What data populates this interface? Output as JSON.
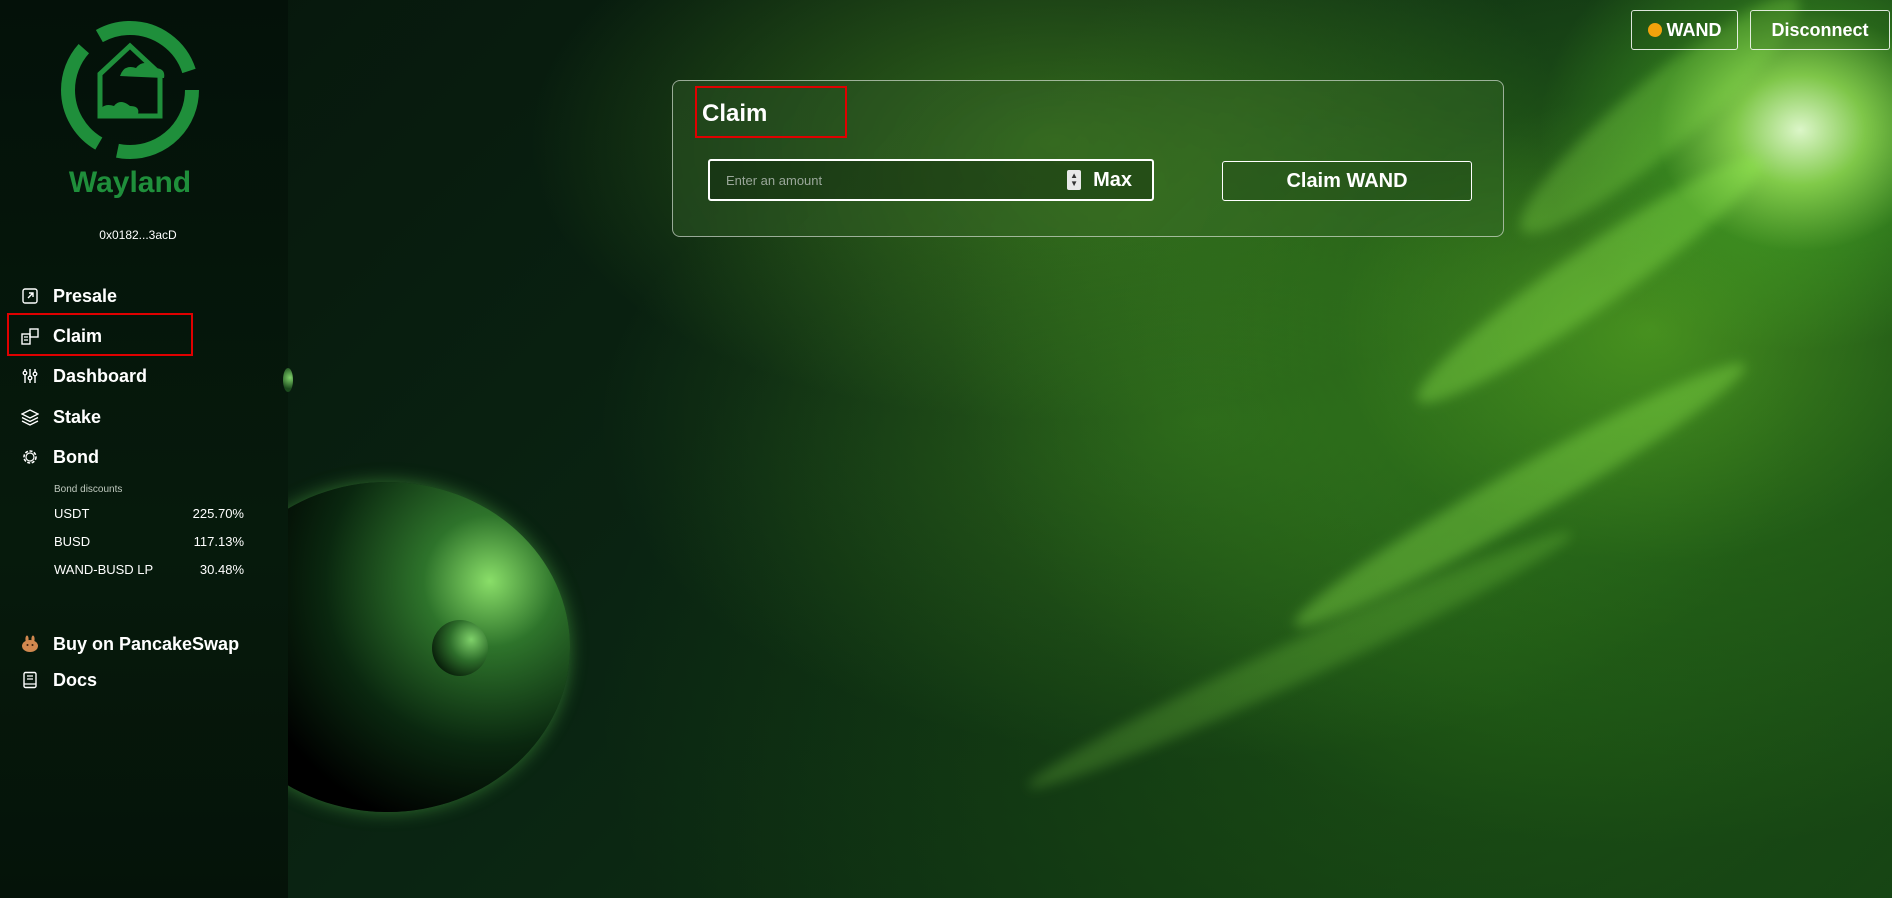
{
  "brand": {
    "name": "Wayland",
    "address": "0x0182...3acD"
  },
  "sidebar": {
    "items": [
      {
        "label": "Presale",
        "icon": "external-link-icon"
      },
      {
        "label": "Claim",
        "icon": "claim-icon"
      },
      {
        "label": "Dashboard",
        "icon": "sliders-icon"
      },
      {
        "label": "Stake",
        "icon": "layers-icon"
      },
      {
        "label": "Bond",
        "icon": "gear-icon"
      }
    ],
    "bond_discounts": {
      "label": "Bond discounts",
      "rows": [
        {
          "name": "USDT",
          "value": "225.70%"
        },
        {
          "name": "BUSD",
          "value": "117.13%"
        },
        {
          "name": "WAND-BUSD LP",
          "value": "30.48%"
        }
      ]
    },
    "links": [
      {
        "label": "Buy on PancakeSwap",
        "icon": "pancake-icon"
      },
      {
        "label": "Docs",
        "icon": "book-icon"
      }
    ]
  },
  "header": {
    "token_label": "WAND",
    "token_dot_color": "#f2a20c",
    "disconnect_label": "Disconnect"
  },
  "claim_card": {
    "title": "Claim",
    "amount_placeholder": "Enter an amount",
    "max_label": "Max",
    "claim_button_label": "Claim WAND"
  },
  "colors": {
    "brand_green": "#1f8f3b",
    "highlight_red": "#e00000"
  }
}
